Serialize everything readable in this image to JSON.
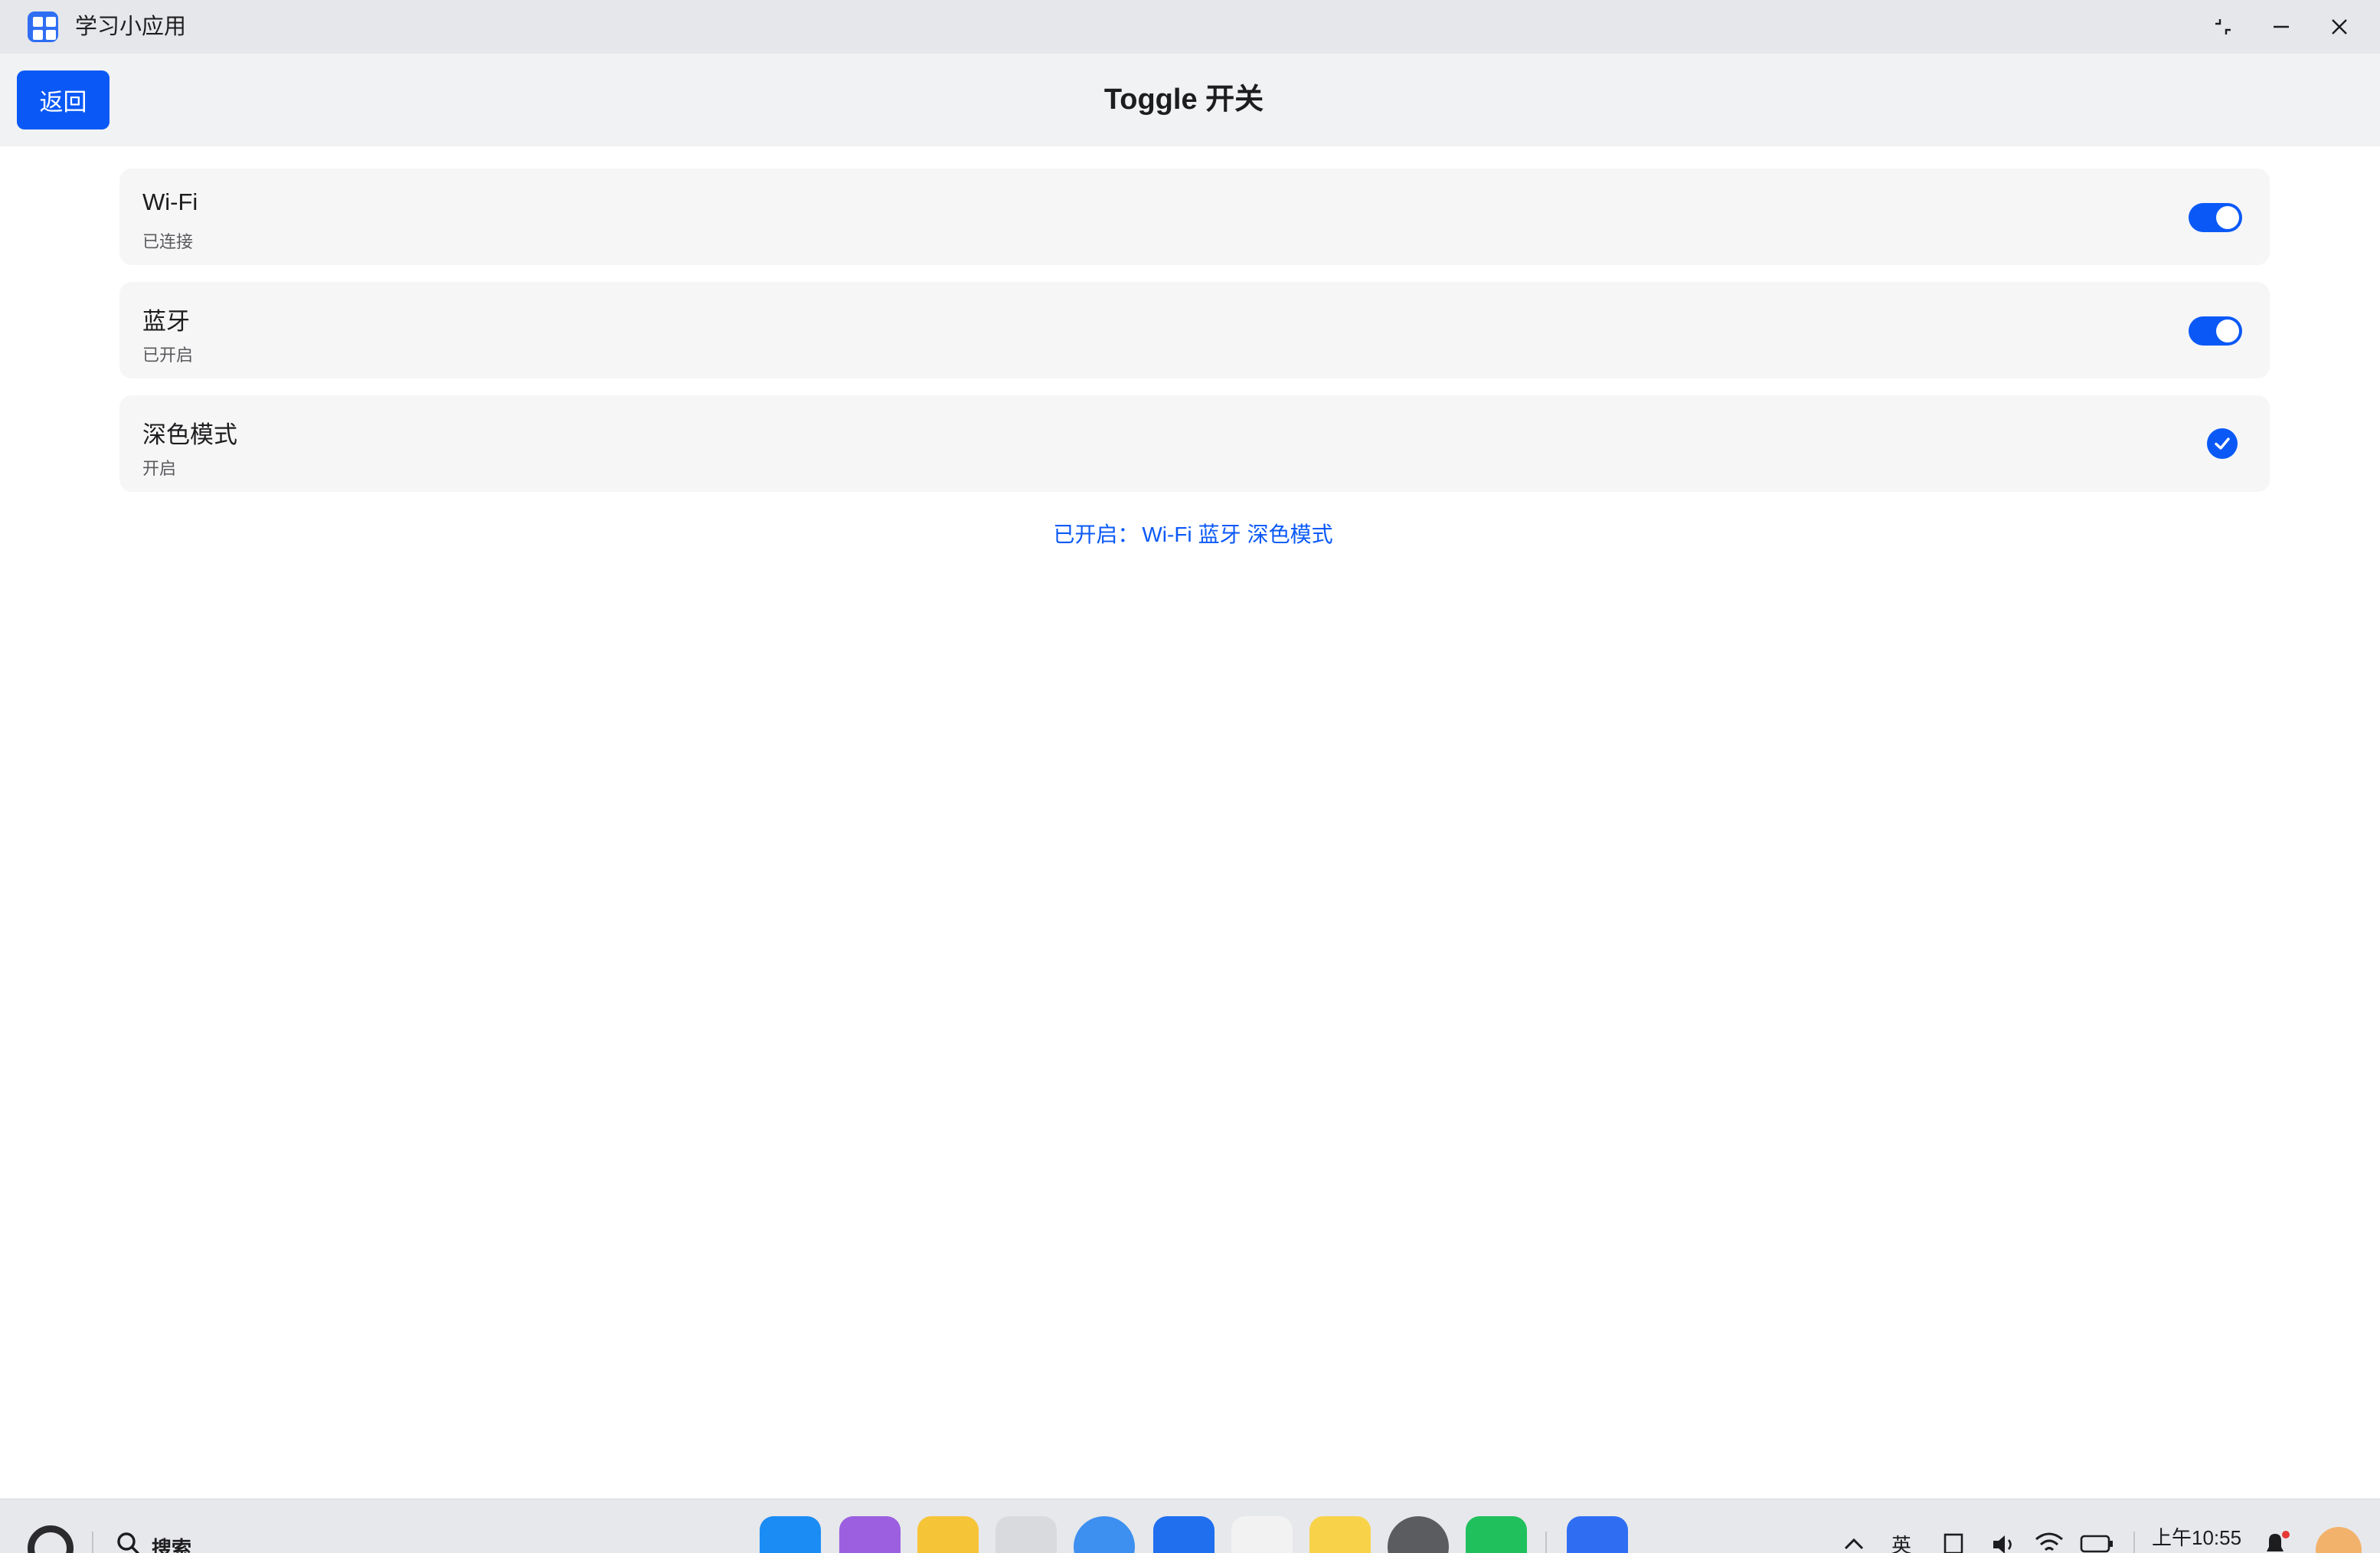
{
  "window": {
    "app_title": "学习小应用"
  },
  "header": {
    "back_label": "返回",
    "title": "Toggle 开关"
  },
  "settings": {
    "items": [
      {
        "label": "Wi-Fi",
        "status": "已连接",
        "control": "switch",
        "on": true
      },
      {
        "label": "蓝牙",
        "status": "已开启",
        "control": "switch",
        "on": true
      },
      {
        "label": "深色模式",
        "status": "开启",
        "control": "checkbox",
        "on": true
      }
    ]
  },
  "summary": {
    "prefix": "已开启：",
    "items": [
      "Wi-Fi",
      "蓝牙",
      "深色模式"
    ]
  },
  "taskbar": {
    "search_label": "搜索",
    "ime_label": "英",
    "clock": "上午10:55",
    "dock_icons": [
      "app-grid",
      "notes",
      "files",
      "trash",
      "browser",
      "mail",
      "photos",
      "memo",
      "settings",
      "wechat",
      "study-app"
    ]
  },
  "colors": {
    "accent": "#0a59f7",
    "titlebar": "#e6e7ea",
    "header": "#f1f2f3",
    "row": "#f6f6f7"
  }
}
